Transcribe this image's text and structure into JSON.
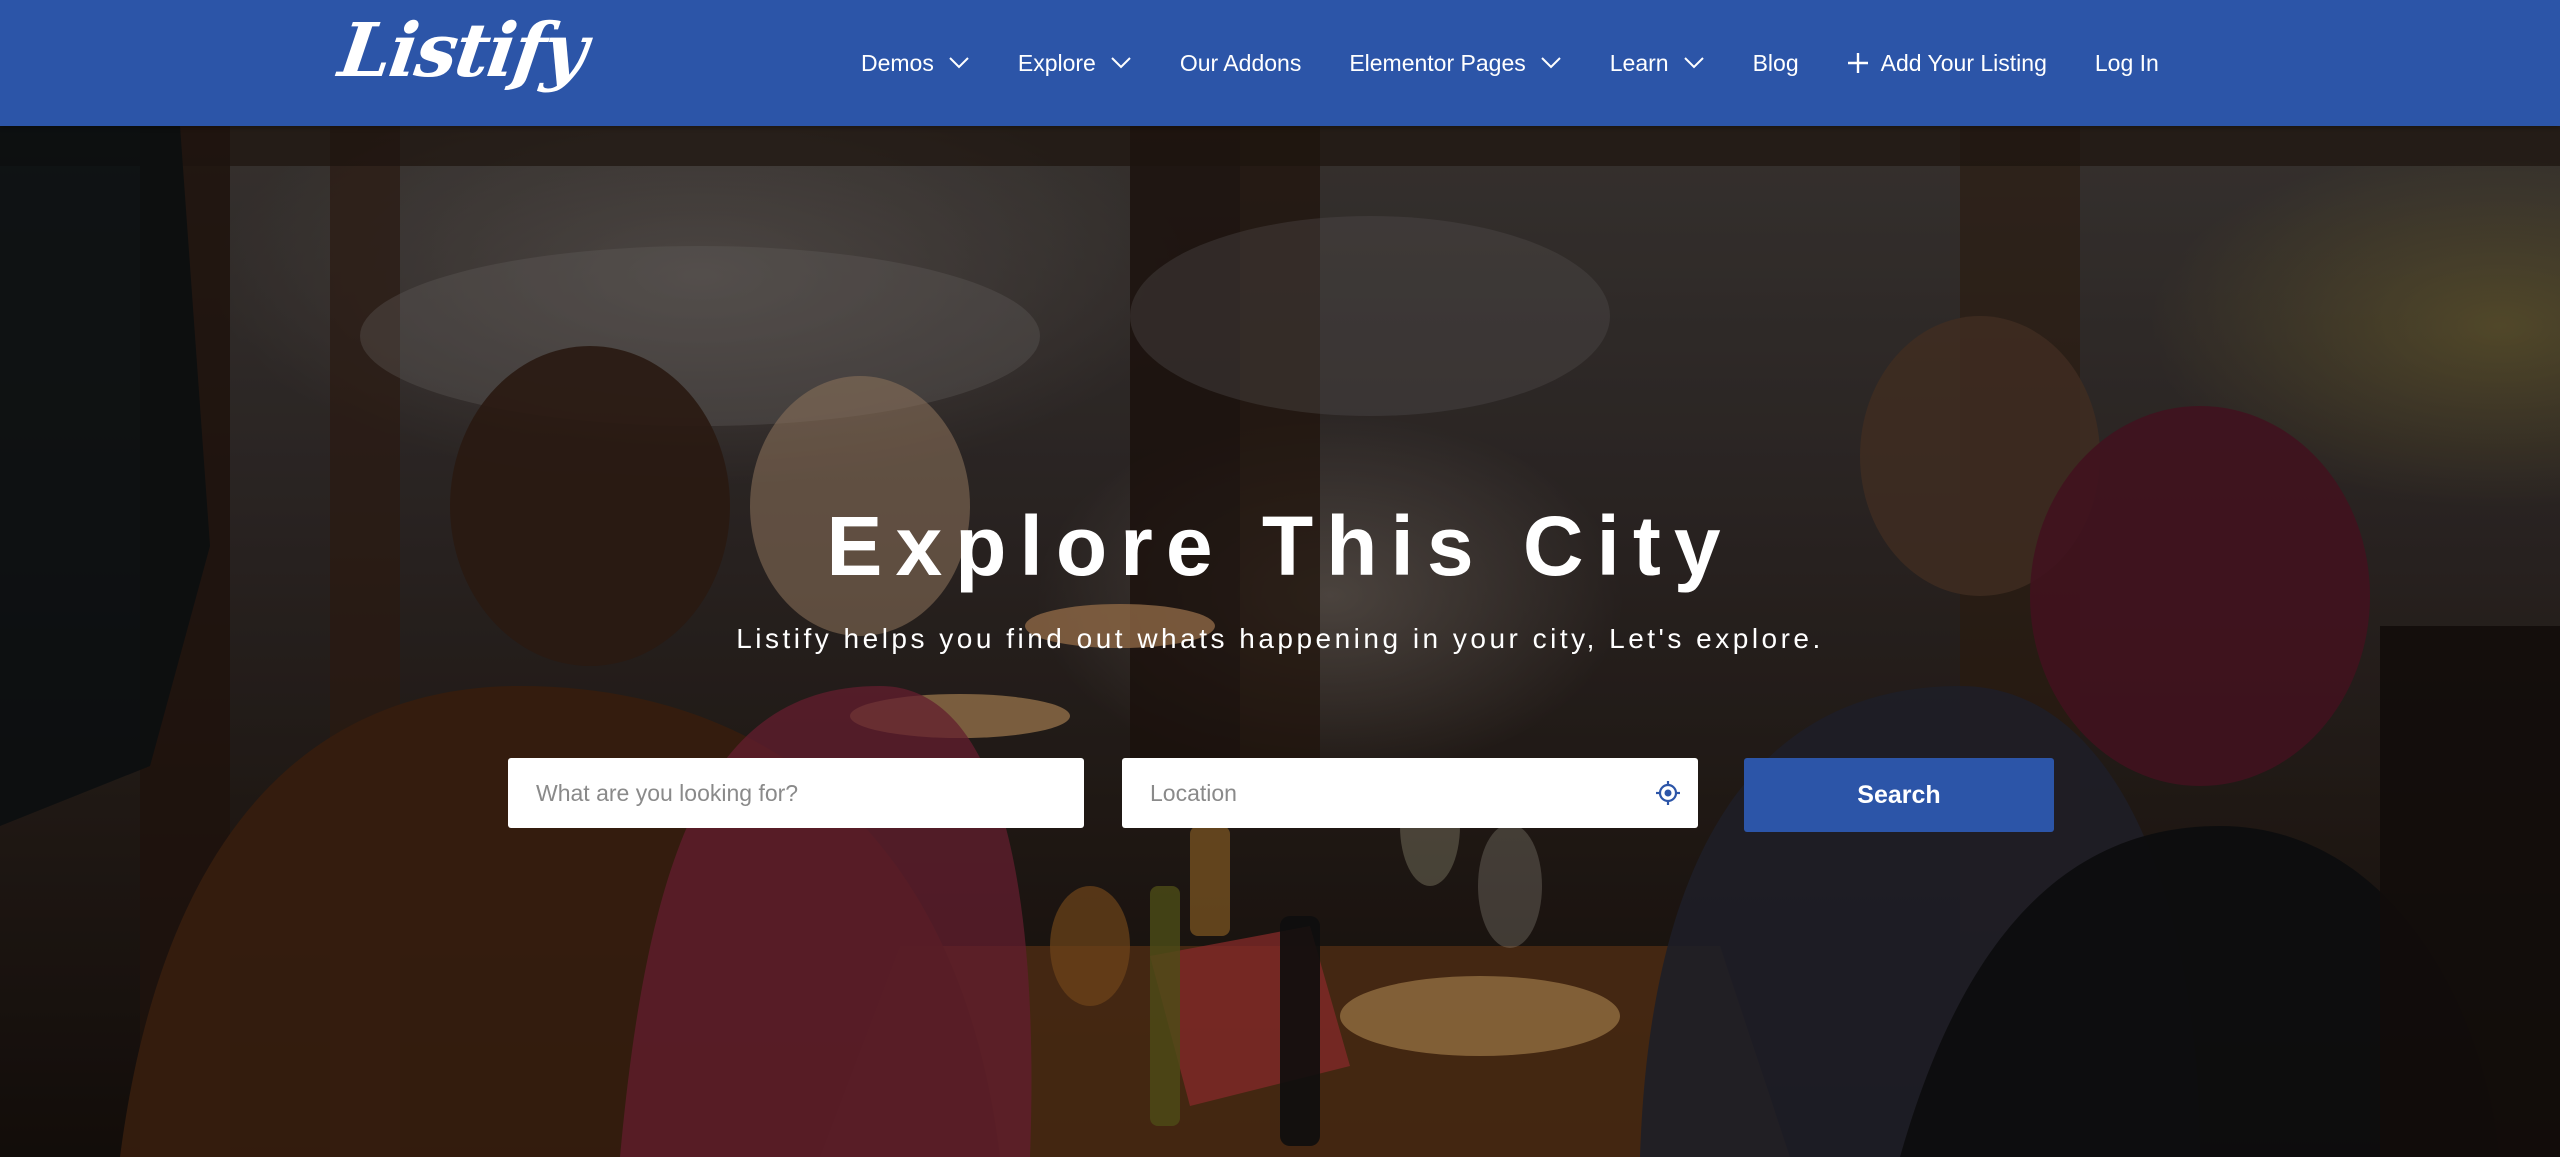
{
  "header": {
    "logo_text": "Listify",
    "nav": [
      {
        "label": "Demos",
        "dropdown": true
      },
      {
        "label": "Explore",
        "dropdown": true
      },
      {
        "label": "Our Addons",
        "dropdown": false
      },
      {
        "label": "Elementor Pages",
        "dropdown": true
      },
      {
        "label": "Learn",
        "dropdown": true
      },
      {
        "label": "Blog",
        "dropdown": false
      }
    ],
    "add_listing_label": "Add Your Listing",
    "login_label": "Log In"
  },
  "hero": {
    "title": "Explore This City",
    "subtitle": "Listify helps you find out whats happening in your city, Let's explore.",
    "search": {
      "what_placeholder": "What are you looking for?",
      "location_placeholder": "Location",
      "button_label": "Search"
    }
  },
  "colors": {
    "brand_blue": "#2c55a8",
    "white": "#ffffff",
    "placeholder_gray": "#8a8a8a"
  },
  "icons": {
    "dropdown": "chevron-down-icon",
    "add": "plus-icon",
    "locate": "crosshair-icon"
  }
}
